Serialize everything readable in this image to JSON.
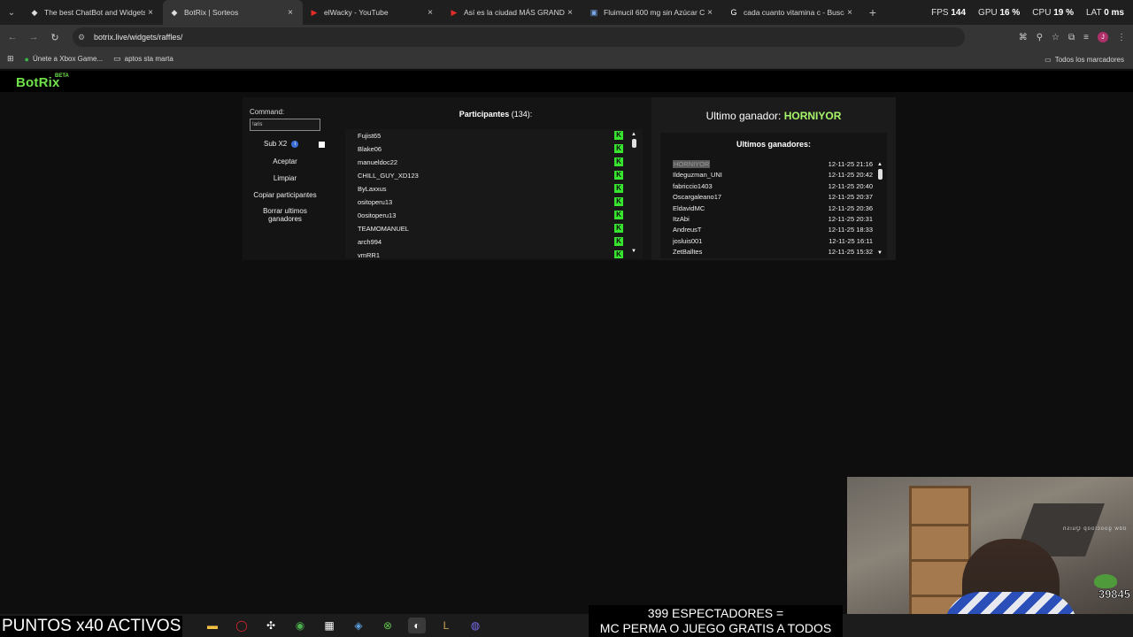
{
  "browser": {
    "tabs": [
      {
        "title": "The best ChatBot and Widgets",
        "icon": "botrix-icon",
        "active": false
      },
      {
        "title": "BotRix | Sorteos",
        "icon": "botrix-icon",
        "active": true
      },
      {
        "title": "elWacky - YouTube",
        "icon": "youtube-icon",
        "active": false
      },
      {
        "title": "Así es la ciudad MÁS GRANDE",
        "icon": "youtube-icon",
        "active": false
      },
      {
        "title": "Fluimucil 600 mg sin Azúcar Ca",
        "icon": "doc-icon",
        "active": false
      },
      {
        "title": "cada cuanto vitamina c - Busca",
        "icon": "google-icon",
        "active": false
      }
    ],
    "url": "botrix.live/widgets/raffles/",
    "bookmarks": [
      {
        "label": "Únete a Xbox Game...",
        "icon": "xbox-icon"
      },
      {
        "label": "aptos sta marta",
        "icon": "folder-icon"
      }
    ],
    "all_bookmarks": "Todos los marcadores"
  },
  "perf": {
    "fps_label": "FPS",
    "fps": "144",
    "gpu_label": "GPU",
    "gpu": "16 %",
    "cpu_label": "CPU",
    "cpu": "19 %",
    "lat_label": "LAT",
    "lat": "0 ms"
  },
  "site": {
    "logo": "BotRix",
    "beta": "BETA"
  },
  "raffle": {
    "command_label": "Command:",
    "command_value": "!aris",
    "sub_label": "Sub X2",
    "buttons": {
      "accept": "Aceptar",
      "clear": "Limpiar",
      "copy": "Copiar participantes",
      "delete_winners": "Borrar ultimos ganadores"
    },
    "participants_label": "Participantes",
    "participants_count": "(134):",
    "participants": [
      "Fujist65",
      "Blake06",
      "manueldoc22",
      "CHILL_GUY_XD123",
      "ByLaxxus",
      "ositoperu13",
      "0ositoperu13",
      "TEAMOMANUEL",
      "arch994",
      "vmRR1"
    ],
    "last_winner_label": "Ultimo ganador:",
    "last_winner": "HORNIYOR",
    "winners_title": "Ultimos ganadores:",
    "winners": [
      {
        "name": "HORNIYOR",
        "date": "12-11-25 21:16"
      },
      {
        "name": "Ildeguzman_UNI",
        "date": "12-11-25 20:42"
      },
      {
        "name": "fabriccio1403",
        "date": "12-11-25 20:40"
      },
      {
        "name": "Oscargaleano17",
        "date": "12-11-25 20:37"
      },
      {
        "name": "EldavidMC",
        "date": "12-11-25 20:36"
      },
      {
        "name": "ItzAbi",
        "date": "12-11-25 20:31"
      },
      {
        "name": "AndreusT",
        "date": "12-11-25 18:33"
      },
      {
        "name": "josluis001",
        "date": "12-11-25 16:11"
      },
      {
        "name": "ZetBalltes",
        "date": "12-11-25 15:32"
      }
    ]
  },
  "stream": {
    "points_banner": "PUNTOS x40 ACTIVOS",
    "viewers_line1": "399 ESPECTADORES =",
    "viewers_line2": "MC PERMA O JUEGO GRATIS A TODOS",
    "cam_count": "39845",
    "cam_mirror_text": "ddw goocloop Quisn"
  },
  "colors": {
    "brand_green": "#6fe24a",
    "kick_green": "#37e52e",
    "winner_highlight": "#a8f56b"
  }
}
